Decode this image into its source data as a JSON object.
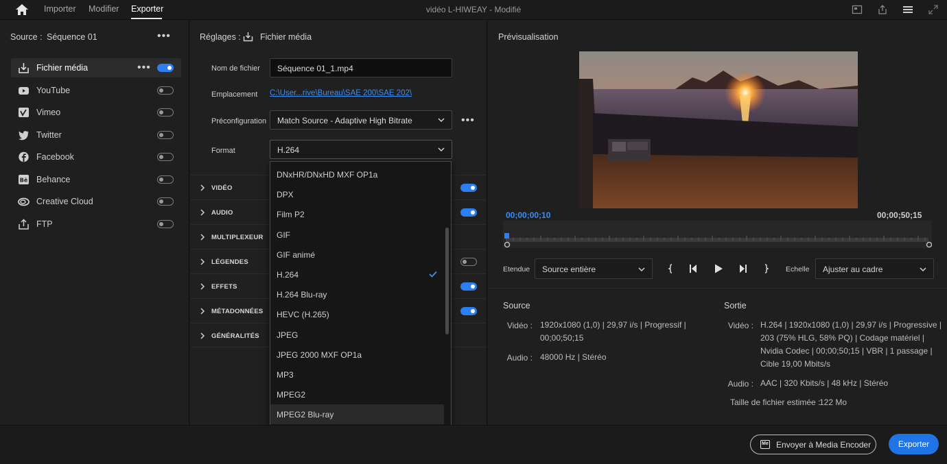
{
  "topbar": {
    "tabs": [
      "Importer",
      "Modifier",
      "Exporter"
    ],
    "active_tab": "Exporter",
    "title": "vidéo L-HIWEAY  - Modifié"
  },
  "source": {
    "label": "Source :",
    "value": "Séquence 01"
  },
  "destinations": [
    {
      "label": "Fichier média",
      "icon": "export-file-icon",
      "enabled": true,
      "selected": true
    },
    {
      "label": "YouTube",
      "icon": "youtube-icon",
      "enabled": false
    },
    {
      "label": "Vimeo",
      "icon": "vimeo-icon",
      "enabled": false
    },
    {
      "label": "Twitter",
      "icon": "twitter-icon",
      "enabled": false
    },
    {
      "label": "Facebook",
      "icon": "facebook-icon",
      "enabled": false
    },
    {
      "label": "Behance",
      "icon": "behance-icon",
      "enabled": false
    },
    {
      "label": "Creative Cloud",
      "icon": "creative-cloud-icon",
      "enabled": false
    },
    {
      "label": "FTP",
      "icon": "ftp-upload-icon",
      "enabled": false
    }
  ],
  "settings": {
    "title": "Réglages :",
    "target": "Fichier média",
    "filename_label": "Nom de fichier",
    "filename_value": "Séquence 01_1.mp4",
    "location_label": "Emplacement",
    "location_value": "C:\\User...rive\\Bureau\\SAE 200\\SAE 202\\",
    "preset_label": "Préconfiguration",
    "preset_value": "Match Source - Adaptive High Bitrate",
    "format_label": "Format",
    "format_value": "H.264",
    "sections": [
      {
        "name": "VIDÉO",
        "toggle": true
      },
      {
        "name": "AUDIO",
        "toggle": true
      },
      {
        "name": "MULTIPLEXEUR",
        "toggle": null
      },
      {
        "name": "LÉGENDES",
        "toggle": false
      },
      {
        "name": "EFFETS",
        "toggle": true
      },
      {
        "name": "MÉTADONNÉES",
        "toggle": true
      },
      {
        "name": "GÉNÉRALITÉS",
        "toggle": null
      }
    ]
  },
  "format_dropdown": {
    "options": [
      "DNxHR/DNxHD MXF OP1a",
      "DPX",
      "Film P2",
      "GIF",
      "GIF animé",
      "H.264",
      "H.264 Blu-ray",
      "HEVC (H.265)",
      "JPEG",
      "JPEG 2000 MXF OP1a",
      "MP3",
      "MPEG2",
      "MPEG2 Blu-ray"
    ],
    "selected": "H.264",
    "highlighted": "MPEG2 Blu-ray"
  },
  "preview": {
    "title": "Prévisualisation",
    "timecode_current": "00;00;00;10",
    "timecode_end": "00;00;50;15",
    "range_label": "Etendue",
    "range_value": "Source entière",
    "scale_label": "Echelle",
    "scale_value": "Ajuster au cadre"
  },
  "info": {
    "source_title": "Source",
    "output_title": "Sortie",
    "source_video_key": "Vidéo :",
    "source_video_lines": [
      "1920x1080 (1,0)  |  29,97 i/s  |  Progressif  |",
      "00;00;50;15"
    ],
    "source_audio_key": "Audio :",
    "source_audio_value": "48000 Hz  |  Stéréo",
    "output_video_key": "Vidéo :",
    "output_video_lines": [
      "H.264  |  1920x1080 (1,0)  |  29,97 i/s  |  Progressive  |",
      "203 (75% HLG, 58% PQ)  |  Codage matériel  |",
      "Nvidia Codec  |  00;00;50;15  |  VBR  |  1 passage  |",
      "Cible 19,00 Mbits/s"
    ],
    "output_audio_key": "Audio :",
    "output_audio_value": "AAC  |  320 Kbits/s  |  48 kHz  |  Stéréo",
    "size_key": "Taille de fichier estimée :",
    "size_value": "122 Mo"
  },
  "actions": {
    "ame_icon_text": "Me",
    "ame_label": "Envoyer à Media Encoder",
    "export_label": "Exporter"
  },
  "colors": {
    "accent": "#1f74e6",
    "link": "#3d8ef2",
    "timecode": "#3d8ef2"
  }
}
